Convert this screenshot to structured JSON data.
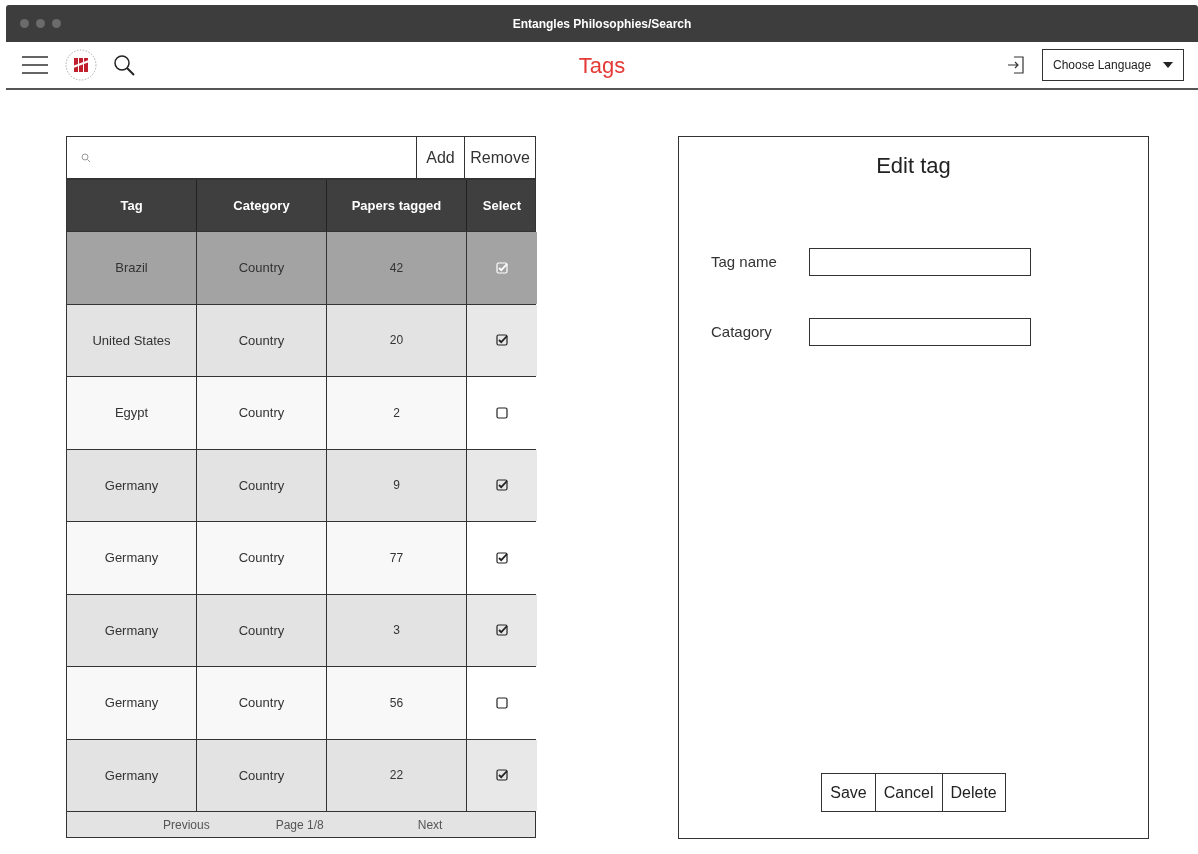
{
  "window": {
    "title": "Entangles Philosophies/Search"
  },
  "header": {
    "title": "Tags",
    "language_select": "Choose Language"
  },
  "table": {
    "actions": [
      "Add",
      "Remove"
    ],
    "columns": [
      "Tag",
      "Category",
      "Papers tagged",
      "Select"
    ],
    "rows": [
      {
        "tag": "Brazil",
        "category": "Country",
        "papers": "42",
        "checked": true,
        "selected": true
      },
      {
        "tag": "United States",
        "category": "Country",
        "papers": "20",
        "checked": true,
        "selected": false
      },
      {
        "tag": "Egypt",
        "category": "Country",
        "papers": "2",
        "checked": false,
        "selected": false
      },
      {
        "tag": "Germany",
        "category": "Country",
        "papers": "9",
        "checked": true,
        "selected": false
      },
      {
        "tag": "Germany",
        "category": "Country",
        "papers": "77",
        "checked": true,
        "selected": false
      },
      {
        "tag": "Germany",
        "category": "Country",
        "papers": "3",
        "checked": true,
        "selected": false
      },
      {
        "tag": "Germany",
        "category": "Country",
        "papers": "56",
        "checked": false,
        "selected": false
      },
      {
        "tag": "Germany",
        "category": "Country",
        "papers": "22",
        "checked": true,
        "selected": false
      }
    ],
    "pagination": {
      "previous": "Previous",
      "page": "Page 1/8",
      "next": "Next"
    }
  },
  "edit_panel": {
    "title": "Edit tag",
    "fields": [
      {
        "label": "Tag name"
      },
      {
        "label": "Catagory"
      }
    ],
    "buttons": [
      "Save",
      "Cancel",
      "Delete"
    ]
  }
}
